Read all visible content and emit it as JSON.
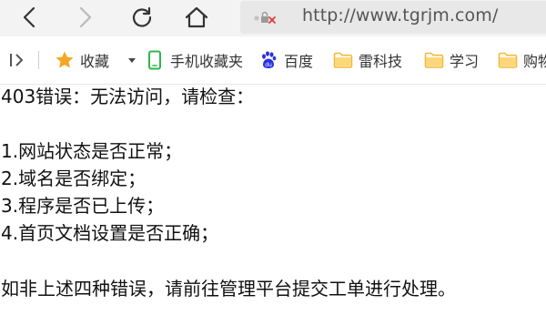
{
  "browser": {
    "url": "http://www.tgrjm.com/"
  },
  "bookmarks": {
    "items": [
      {
        "label": "收藏",
        "icon": "star-icon"
      },
      {
        "label": "手机收藏夹",
        "icon": "phone-icon"
      },
      {
        "label": "百度",
        "icon": "baidu-paw-icon"
      },
      {
        "label": "雷科技",
        "icon": "folder-icon"
      },
      {
        "label": "学习",
        "icon": "folder-icon"
      },
      {
        "label": "购物",
        "icon": "folder-icon"
      }
    ]
  },
  "page": {
    "heading": "403错误：无法访问，请检查：",
    "checks": [
      "1.网站状态是否正常；",
      "2.域名是否绑定；",
      "3.程序是否已上传；",
      "4.首页文档设置是否正确；"
    ],
    "footer": "如非上述四种错误，请前往管理平台提交工单进行处理。"
  },
  "colors": {
    "toolbar_bg": "#f3f3f3",
    "address_bg": "#e8e8e8",
    "star": "#f5a623",
    "phone": "#2db84d",
    "baidu": "#2932e1",
    "folder": "#f5c04a",
    "security_red": "#e53935"
  }
}
